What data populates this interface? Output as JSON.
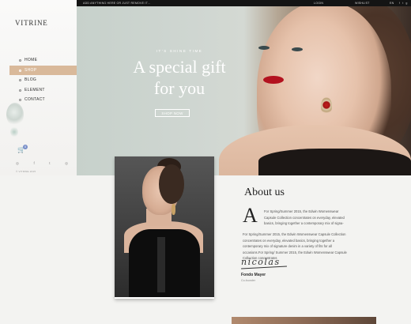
{
  "topbar": {
    "notice": "ADD ANYTHING HERE OR JUST REMOVE IT...",
    "login": "LOGIN",
    "wishlist": "WISHLIST",
    "currency": "EN",
    "socials": [
      "f",
      "t",
      "g"
    ]
  },
  "sidebar": {
    "logo": "VITRINE",
    "nav": [
      {
        "label": "HOME",
        "active": false
      },
      {
        "label": "SHOP",
        "active": true
      },
      {
        "label": "BLOG",
        "active": false
      },
      {
        "label": "ELEMENT",
        "active": false
      },
      {
        "label": "CONTACT",
        "active": false
      }
    ],
    "cart_icon": "cart-icon",
    "cart_count": "0",
    "socials": [
      "◎",
      "f",
      "t",
      "◎"
    ],
    "copyright": "© VITRINE 2015"
  },
  "hero": {
    "kicker": "IT'S SHINE TIME",
    "title_line1": "A special gift",
    "title_line2": "for you",
    "button": "SHOP NOW"
  },
  "about": {
    "title": "About us",
    "dropcap": "A",
    "paragraph1": "For Spring/Summer 2015, the Edwin Womenswear Capsule Collection concentrates on everyday, elevated basics, bringing together a contemporary mix of signa-",
    "paragraph2": "For Spring/Summer 2015, the Edwin Womenswear Capsule Collection concentrates on everyday, elevated basics, bringing together a contemporary mix of signature denim in a variety of fits for all occasions.For Spring/ Summer 2015, the Edwin Womenswear Capsule Collection concentrates",
    "signature": "nicolas",
    "name": "Fondo Mayer",
    "role": "Co-founder"
  },
  "colors": {
    "accent": "#d9b99a",
    "topbar": "#141414",
    "badge": "#7a8fc9"
  }
}
